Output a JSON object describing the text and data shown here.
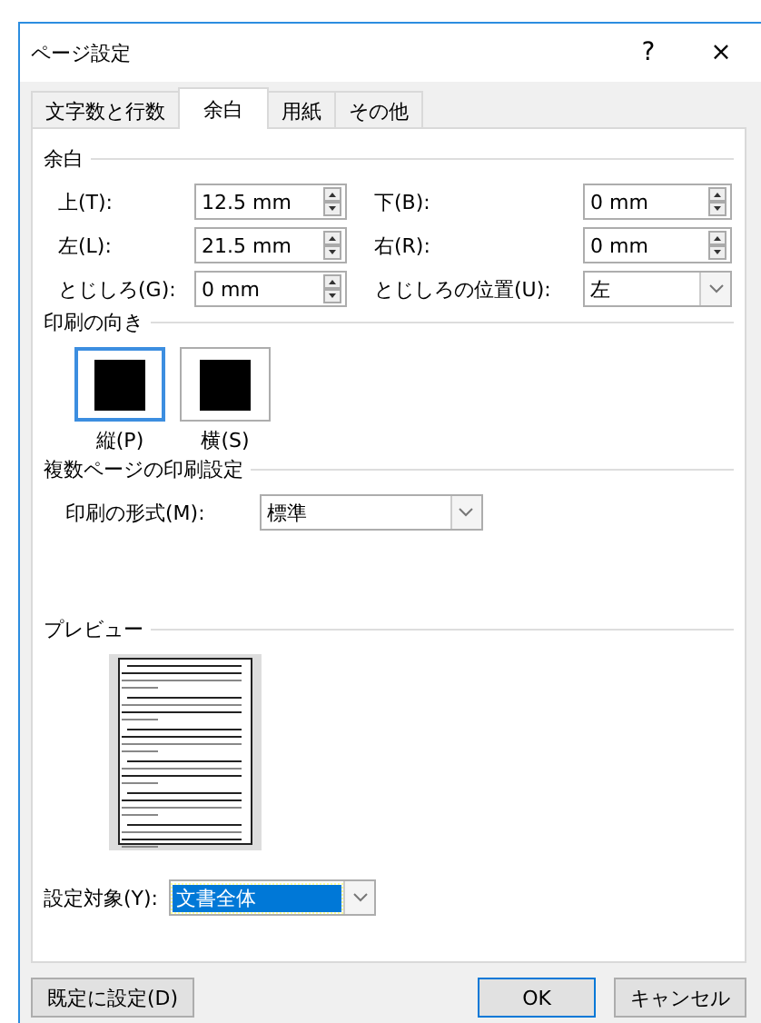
{
  "window": {
    "title": "ページ設定",
    "help": "?",
    "close": "×"
  },
  "tabs": [
    {
      "label": "文字数と行数",
      "selected": false
    },
    {
      "label": "余白",
      "selected": true
    },
    {
      "label": "用紙",
      "selected": false
    },
    {
      "label": "その他",
      "selected": false
    }
  ],
  "margins": {
    "heading": "余白",
    "fields": [
      {
        "label": "上(T):",
        "value": "12.5 mm",
        "kind": "spin"
      },
      {
        "label": "下(B):",
        "value": "0 mm",
        "kind": "spin"
      },
      {
        "label": "左(L):",
        "value": "21.5 mm",
        "kind": "spin"
      },
      {
        "label": "右(R):",
        "value": "0 mm",
        "kind": "spin"
      },
      {
        "label": "とじしろ(G):",
        "value": "0 mm",
        "kind": "spin"
      },
      {
        "label": "とじしろの位置(U):",
        "value": "左",
        "kind": "dropdown"
      }
    ]
  },
  "orientation": {
    "heading": "印刷の向き",
    "options": [
      {
        "label": "縦(P)",
        "selected": true
      },
      {
        "label": "横(S)",
        "selected": false
      }
    ]
  },
  "multiple_pages": {
    "heading": "複数ページの印刷設定",
    "label": "印刷の形式(M):",
    "value": "標準"
  },
  "preview": {
    "heading": "プレビュー"
  },
  "apply_to": {
    "label": "設定対象(Y):",
    "value": "文書全体"
  },
  "buttons": [
    {
      "label": "既定に設定(D)",
      "kind": "normal"
    },
    {
      "label": "OK",
      "kind": "default"
    },
    {
      "label": "キャンセル",
      "kind": "normal"
    }
  ]
}
